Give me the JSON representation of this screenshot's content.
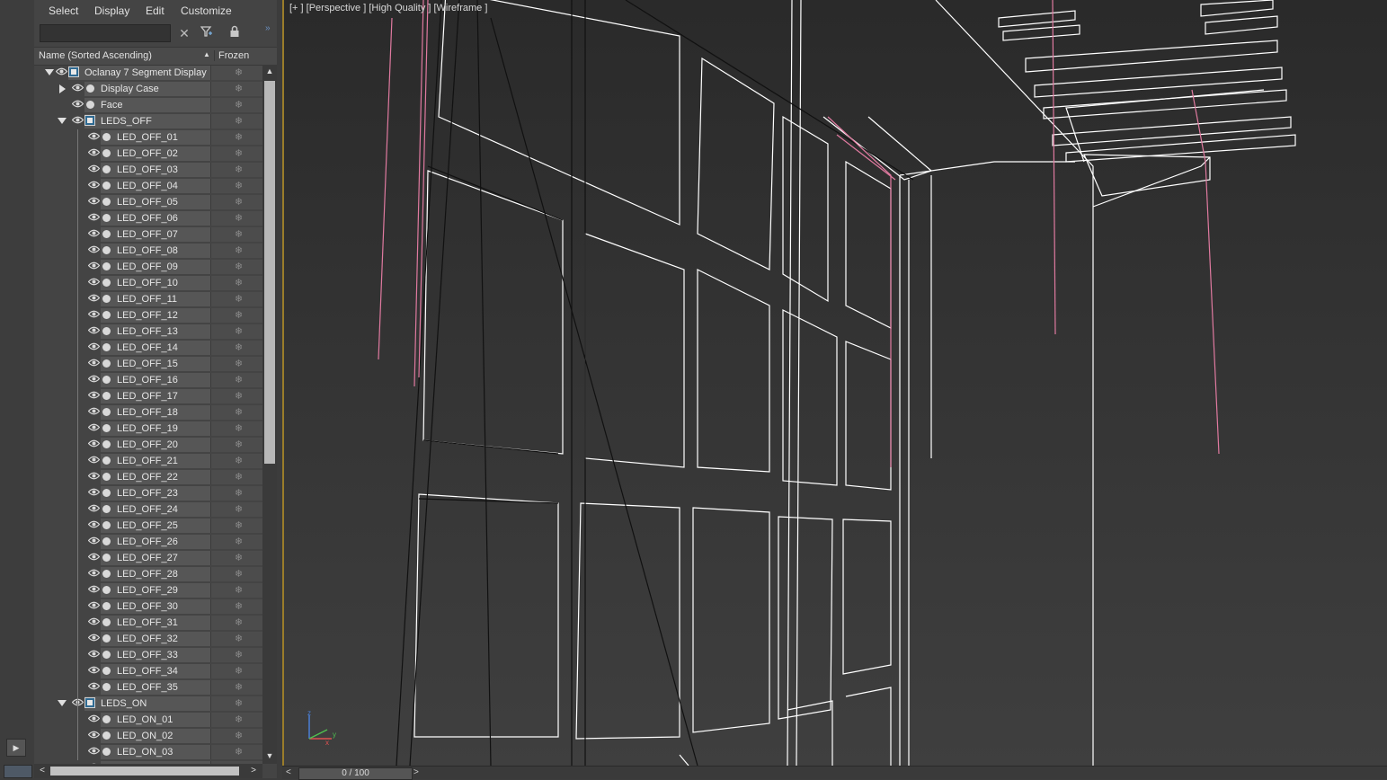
{
  "menu": [
    "Select",
    "Display",
    "Edit",
    "Customize"
  ],
  "search": {
    "value": "",
    "placeholder": ""
  },
  "columns": {
    "name": "Name (Sorted Ascending)",
    "frozen": "Frozen"
  },
  "tree": {
    "root": "Oclanay 7 Segment Display",
    "display_case": "Display Case",
    "face": "Face",
    "leds_off_group": "LEDS_OFF",
    "leds_off": [
      "LED_OFF_01",
      "LED_OFF_02",
      "LED_OFF_03",
      "LED_OFF_04",
      "LED_OFF_05",
      "LED_OFF_06",
      "LED_OFF_07",
      "LED_OFF_08",
      "LED_OFF_09",
      "LED_OFF_10",
      "LED_OFF_11",
      "LED_OFF_12",
      "LED_OFF_13",
      "LED_OFF_14",
      "LED_OFF_15",
      "LED_OFF_16",
      "LED_OFF_17",
      "LED_OFF_18",
      "LED_OFF_19",
      "LED_OFF_20",
      "LED_OFF_21",
      "LED_OFF_22",
      "LED_OFF_23",
      "LED_OFF_24",
      "LED_OFF_25",
      "LED_OFF_26",
      "LED_OFF_27",
      "LED_OFF_28",
      "LED_OFF_29",
      "LED_OFF_30",
      "LED_OFF_31",
      "LED_OFF_32",
      "LED_OFF_33",
      "LED_OFF_34",
      "LED_OFF_35"
    ],
    "leds_on_group": "LEDS_ON",
    "leds_on": [
      "LED_ON_01",
      "LED_ON_02",
      "LED_ON_03"
    ]
  },
  "viewport": {
    "label": "[+ ] [Perspective ] [High Quality ] [Wireframe ]"
  },
  "timeline": {
    "frame": "0 / 100",
    "prev": "<",
    "next": ">"
  },
  "colors": {
    "accent_border": "#9a7d2a",
    "selection_pink": "#e07aa0",
    "wire": "#ffffff"
  }
}
